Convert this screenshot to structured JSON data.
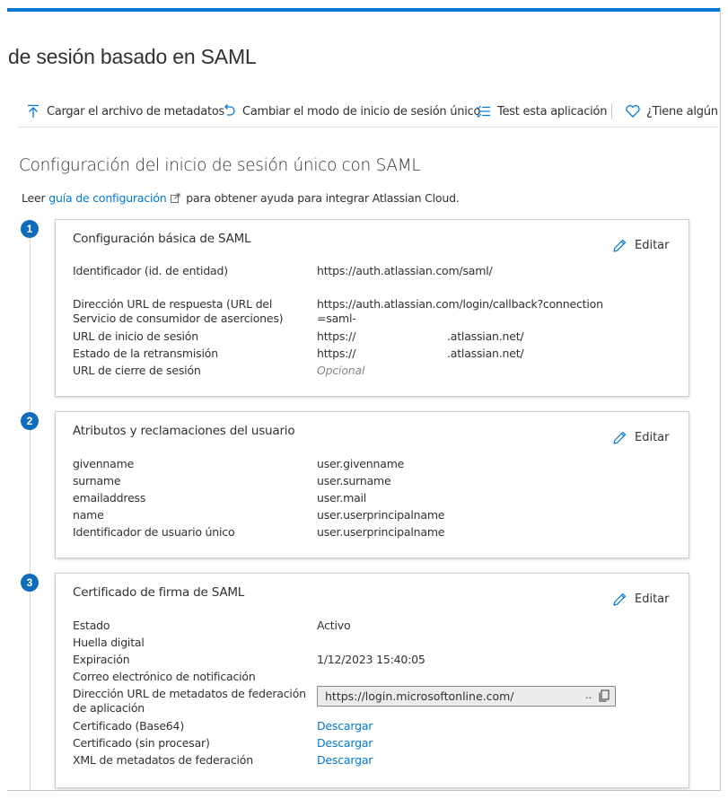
{
  "page": {
    "title": "de sesión basado en SAML"
  },
  "toolbar": {
    "upload_metadata": "Cargar el archivo de metadatos",
    "change_sso_mode": "Cambiar el modo de inicio de sesión único",
    "test_app": "Test esta aplicación",
    "feedback": "¿Tiene algún c"
  },
  "main": {
    "section_title": "Configuración del inicio de sesión único con SAML",
    "intro_prefix": "Leer",
    "intro_link": "guía de configuración",
    "intro_suffix": "para obtener ayuda para integrar Atlassian Cloud."
  },
  "edit_label": "Editar",
  "steps": [
    "1",
    "2",
    "3"
  ],
  "card1": {
    "title": "Configuración básica de SAML",
    "rows": [
      {
        "label": "Identificador (id. de entidad)",
        "value": "https://auth.atlassian.com/saml/"
      },
      {
        "label": "Dirección URL de respuesta (URL del Servicio de consumidor de aserciones)",
        "value": "https://auth.atlassian.com/login/callback?connection=saml-"
      },
      {
        "label": "URL de inicio de sesión",
        "value_start": "https://",
        "value_end": ".atlassian.net/"
      },
      {
        "label": "Estado de la retransmisión",
        "value_start": "https://",
        "value_end": ".atlassian.net/"
      },
      {
        "label": "URL de cierre de sesión",
        "value": "Opcional"
      }
    ]
  },
  "card2": {
    "title": "Atributos y reclamaciones del usuario",
    "rows": [
      {
        "label": "givenname",
        "value": "user.givenname"
      },
      {
        "label": "surname",
        "value": "user.surname"
      },
      {
        "label": "emailaddress",
        "value": "user.mail"
      },
      {
        "label": "name",
        "value": "user.userprincipalname"
      },
      {
        "label": "Identificador de usuario único",
        "value": "user.userprincipalname"
      }
    ]
  },
  "card3": {
    "title": "Certificado de firma de SAML",
    "rows": [
      {
        "label": "Estado",
        "value": "Activo"
      },
      {
        "label": "Huella digital",
        "value": ""
      },
      {
        "label": "Expiración",
        "value": "1/12/2023 15:40:05"
      },
      {
        "label": "Correo electrónico de notificación",
        "value": ""
      },
      {
        "label": "Dirección URL de metadatos de federación de aplicación",
        "value": "https://login.microsoftonline.com/",
        "ellipsis": ".."
      },
      {
        "label": "Certificado (Base64)",
        "value": "Descargar"
      },
      {
        "label": "Certificado (sin procesar)",
        "value": "Descargar"
      },
      {
        "label": "XML de metadatos de federación",
        "value": "Descargar"
      }
    ]
  },
  "colors": {
    "accent": "#0078d4",
    "badge": "#0f6cbd",
    "border": "#d2d0ce"
  }
}
